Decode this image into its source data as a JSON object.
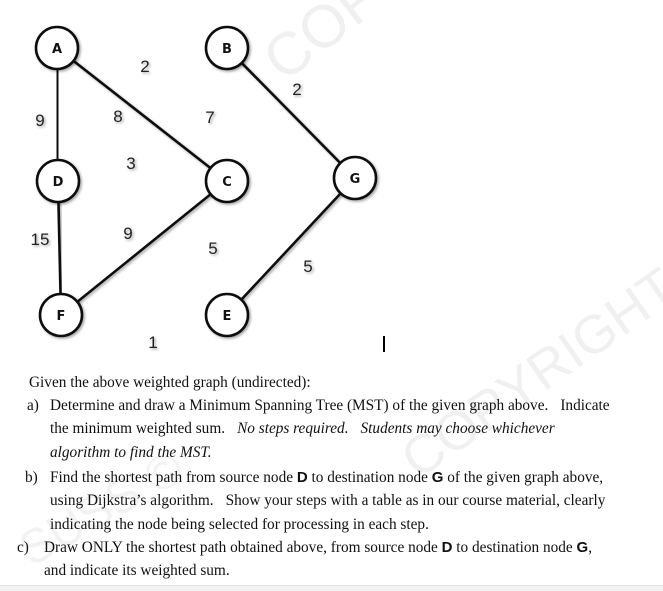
{
  "graph": {
    "type": "undirected-weighted-graph",
    "nodes": [
      {
        "id": "A",
        "label": "A"
      },
      {
        "id": "B",
        "label": "B"
      },
      {
        "id": "C",
        "label": "C"
      },
      {
        "id": "D",
        "label": "D"
      },
      {
        "id": "E",
        "label": "E"
      },
      {
        "id": "F",
        "label": "F"
      },
      {
        "id": "G",
        "label": "G"
      }
    ],
    "edges": [
      {
        "from": "A",
        "to": "B",
        "weight": "2"
      },
      {
        "from": "A",
        "to": "D",
        "weight": "9"
      },
      {
        "from": "A",
        "to": "C",
        "weight": "8"
      },
      {
        "from": "B",
        "to": "C",
        "weight": "7"
      },
      {
        "from": "B",
        "to": "G",
        "weight": "2"
      },
      {
        "from": "D",
        "to": "C",
        "weight": "3"
      },
      {
        "from": "D",
        "to": "F",
        "weight": "15"
      },
      {
        "from": "F",
        "to": "C",
        "weight": "9"
      },
      {
        "from": "C",
        "to": "E",
        "weight": "5"
      },
      {
        "from": "E",
        "to": "G",
        "weight": "5"
      },
      {
        "from": "F",
        "to": "E",
        "weight": "1"
      }
    ]
  },
  "watermark": {
    "text1": "COPYRIGHT",
    "text2": "COPYRIGHT",
    "text3": "SUSS ©"
  },
  "question": {
    "intro": "Given the above weighted graph (undirected):",
    "a": {
      "marker": "a)",
      "line1": "Determine and draw a Minimum Spanning Tree (MST) of the given graph above.",
      "line1_tail": "Indicate",
      "line2_plain": "the minimum weighted sum.",
      "line2_italic1": "No steps required.",
      "line2_italic2": "Students may choose whichever",
      "line3_italic": "algorithm to find the MST."
    },
    "b": {
      "marker": "b)",
      "line1_pre": "Find the shortest path from source node ",
      "source": "D",
      "line1_mid": " to destination node ",
      "dest": "G",
      "line1_post": " of the given graph above,",
      "line2_a": "using Dijkstra’s algorithm.",
      "line2_b": "Show your steps with a table as in our course material, clearly",
      "line3": "indicating the node being selected for processing in each step."
    },
    "c": {
      "marker": "c)",
      "line1_pre": "Draw ONLY the shortest path obtained above, from source node ",
      "source": "D",
      "line1_mid": " to destination node ",
      "dest": "G",
      "line1_post": ",",
      "line2": "and indicate its weighted sum."
    }
  }
}
